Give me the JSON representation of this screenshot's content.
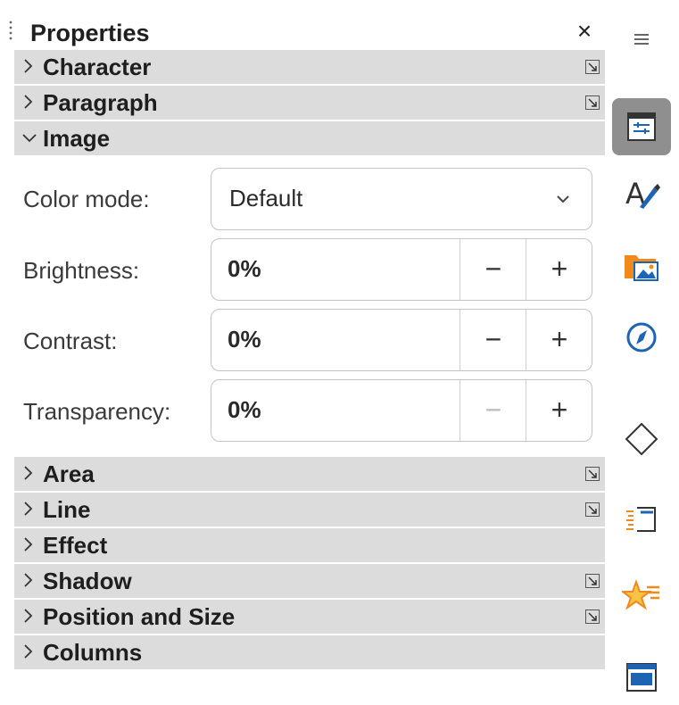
{
  "panel": {
    "title": "Properties",
    "close_glyph": "×"
  },
  "sections_top": [
    {
      "label": "Character",
      "expanded": false,
      "has_more": true
    },
    {
      "label": "Paragraph",
      "expanded": false,
      "has_more": true
    },
    {
      "label": "Image",
      "expanded": true,
      "has_more": false
    }
  ],
  "image": {
    "color_mode": {
      "label": "Color mode:",
      "value": "Default"
    },
    "brightness": {
      "label": "Brightness:",
      "value": "0%",
      "minus": "−",
      "plus": "+",
      "minus_enabled": true
    },
    "contrast": {
      "label": "Contrast:",
      "value": "0%",
      "minus": "−",
      "plus": "+",
      "minus_enabled": true
    },
    "transparency": {
      "label": "Transparency:",
      "value": "0%",
      "minus": "−",
      "plus": "+",
      "minus_enabled": false
    }
  },
  "sections_bottom": [
    {
      "label": "Area",
      "has_more": true
    },
    {
      "label": "Line",
      "has_more": true
    },
    {
      "label": "Effect",
      "has_more": false
    },
    {
      "label": "Shadow",
      "has_more": true
    },
    {
      "label": "Position and Size",
      "has_more": true
    },
    {
      "label": "Columns",
      "has_more": false
    }
  ],
  "sidebar": {
    "items": [
      {
        "icon": "menu-icon",
        "active": false
      },
      {
        "icon": "properties-icon",
        "active": true
      },
      {
        "icon": "styles-icon",
        "active": false
      },
      {
        "icon": "gallery-icon",
        "active": false
      },
      {
        "icon": "navigator-icon",
        "active": false
      },
      {
        "icon": "shapes-icon",
        "active": false
      },
      {
        "icon": "page-icon",
        "active": false
      },
      {
        "icon": "animation-icon",
        "active": false
      },
      {
        "icon": "design-icon",
        "active": false
      }
    ]
  },
  "colors": {
    "section_bg": "#dcdcdc",
    "active_tab": "#8f8f8f",
    "accent": "#1e64b4",
    "orange": "#f08a1c"
  }
}
